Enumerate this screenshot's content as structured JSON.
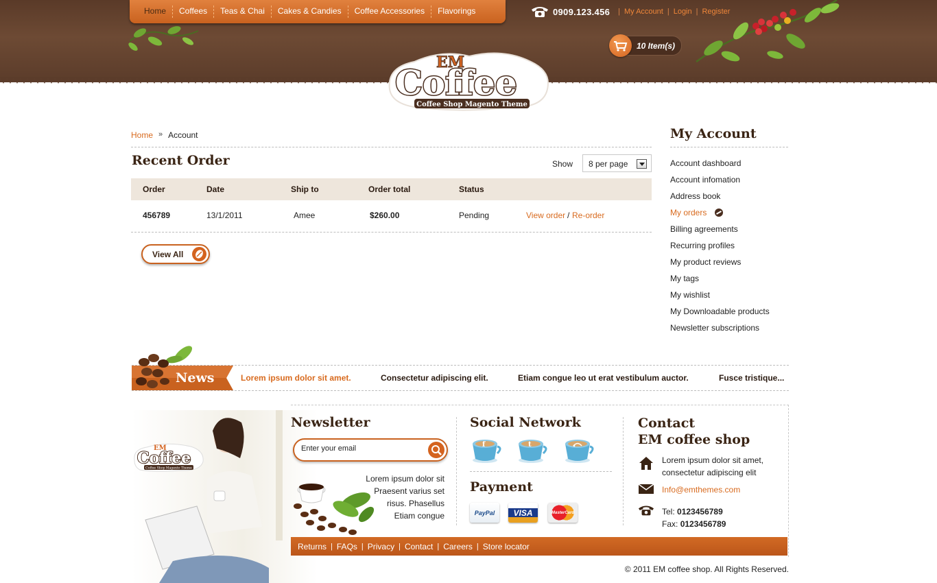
{
  "colors": {
    "accent": "#d86a1e",
    "header_brown": "#5a3a28",
    "title_brown": "#3a2414",
    "table_head_bg": "#eee6dc"
  },
  "header": {
    "nav": [
      "Home",
      "Coffees",
      "Teas & Chai",
      "Cakes & Candies",
      "Coffee Accessories",
      "Flavorings"
    ],
    "phone": "0909.123.456",
    "links": {
      "my_account": "My Account",
      "login": "Login",
      "register": "Register"
    },
    "cart": "10 Item(s)",
    "logo": {
      "top": "EM",
      "main": "Coffee",
      "tagline": "Coffee Shop Magento Theme"
    }
  },
  "breadcrumb": {
    "home": "Home",
    "separator": "»",
    "current": "Account"
  },
  "recent_order": {
    "title": "Recent Order",
    "show_label": "Show",
    "per_page": "8 per page",
    "columns": [
      "Order",
      "Date",
      "Ship to",
      "Order total",
      "Status"
    ],
    "row": {
      "order": "456789",
      "date": "13/1/2011",
      "ship_to": "Amee",
      "total": "$260.00",
      "status": "Pending",
      "view_order": "View order",
      "link_sep": "/",
      "reorder": "Re-order"
    },
    "view_all": "View All"
  },
  "sidebar": {
    "title": "My Account",
    "items": [
      "Account dashboard",
      "Account infomation",
      "Address book",
      "My orders",
      "Billing agreements",
      "Recurring profiles",
      "My product reviews",
      "My tags",
      "My wishlist",
      "My Downloadable products",
      "Newsletter subscriptions"
    ],
    "active_index": 3
  },
  "news": {
    "label": "News",
    "items": [
      "Lorem ipsum dolor sit amet.",
      "Consectetur adipiscing elit.",
      "Etiam congue leo ut erat vestibulum auctor.",
      "Fusce tristique..."
    ]
  },
  "footer": {
    "newsletter": {
      "title": "Newsletter",
      "placeholder": "Enter your email",
      "text": [
        "Lorem ipsum dolor sit",
        "Praesent varius set",
        "risus. Phasellus",
        "Etiam congue"
      ]
    },
    "social": {
      "title": "Social Network",
      "icons": [
        "facebook-icon",
        "twitter-icon",
        "rss-icon"
      ]
    },
    "payment": {
      "title": "Payment",
      "cards": [
        "PayPal",
        "VISA",
        "MasterCard"
      ]
    },
    "contact": {
      "title_line1": "Contact",
      "title_line2": "EM coffee shop",
      "address": "Lorem ipsum dolor sit amet, consectetur adipiscing elit",
      "email": "Info@emthemes.com",
      "tel_label": "Tel:",
      "tel": "0123456789",
      "fax_label": "Fax:",
      "fax": "0123456789"
    },
    "links": [
      "Returns",
      "FAQs",
      "Privacy",
      "Contact",
      "Careers",
      "Store locator"
    ],
    "copyright": "© 2011 EM coffee shop. All Rights Reserved."
  }
}
